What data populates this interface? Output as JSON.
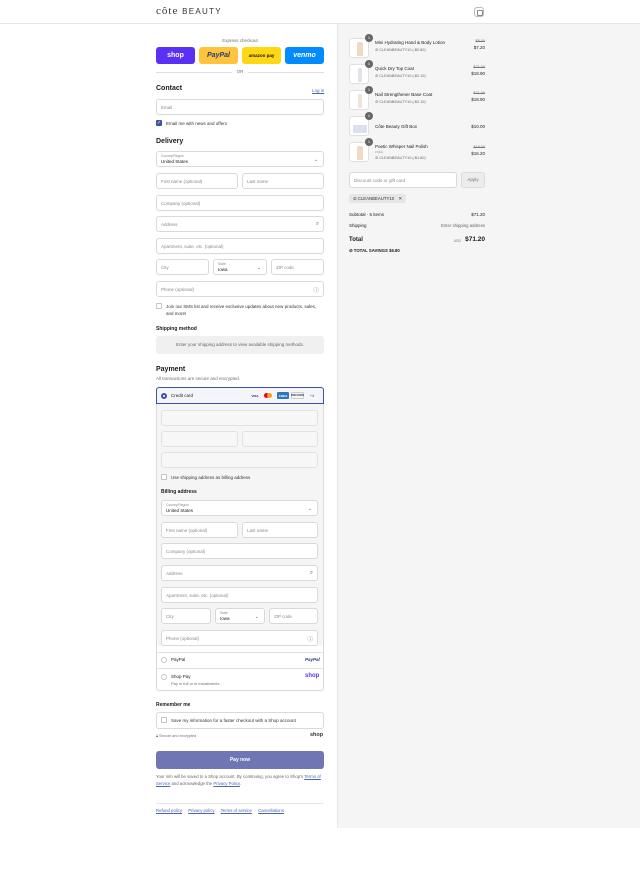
{
  "header": {
    "logo_main": "côte",
    "logo_sub": "BEAUTY"
  },
  "express": {
    "title": "Express checkout",
    "shop": "shop",
    "paypal": "PayPal",
    "amazon": "amazon pay",
    "venmo": "venmo",
    "or": "OR"
  },
  "contact": {
    "title": "Contact",
    "login": "Log in",
    "email_placeholder": "Email",
    "news_label": "Email me with news and offers"
  },
  "delivery": {
    "title": "Delivery",
    "country_label": "Country/Region",
    "country_value": "United States",
    "first_name": "First name (optional)",
    "last_name": "Last name",
    "company": "Company (optional)",
    "address": "Address",
    "apartment": "Apartment, suite, etc. (optional)",
    "city": "City",
    "state_label": "State",
    "state_value": "Iowa",
    "zip": "ZIP code",
    "phone": "Phone (optional)",
    "sms_label": "Join our SMS list and receive exclusive updates about new products, sales, and more!"
  },
  "shipping_method": {
    "title": "Shipping method",
    "message": "Enter your shipping address to view available shipping methods."
  },
  "payment": {
    "title": "Payment",
    "subtitle": "All transactions are secure and encrypted.",
    "credit_card": "Credit card",
    "brands": [
      "VISA",
      "MC",
      "AMEX",
      "DISCOVER"
    ],
    "more_brands": "+4",
    "use_shipping": "Use shipping address as billing address",
    "billing_title": "Billing address",
    "paypal": "PayPal",
    "paypal_logo": "PayPal",
    "shop_pay": "Shop Pay",
    "shop_pay_sub": "Pay in full or in installments",
    "shop_logo": "shop"
  },
  "remember": {
    "title": "Remember me",
    "label": "Save my information for a faster checkout with a Shop account",
    "secure": "Secure and encrypted",
    "shop_logo": "shop"
  },
  "pay_now": "Pay now",
  "terms": {
    "text1": "Your info will be saved to a Shop account. By continuing, you agree to Shop’s",
    "tos": "Terms of Service",
    "text2": "and acknowledge the",
    "privacy": "Privacy Policy",
    "end": "."
  },
  "footer": [
    "Refund policy",
    "Privacy policy",
    "Terms of service",
    "Cancellations"
  ],
  "order": {
    "items": [
      {
        "qty": "1",
        "name": "Mini Hydrating Hand & Body Lotion",
        "discount": "CLEANBEAUTY10 (-$0.80)",
        "original": "$8.00",
        "price": "$7.20",
        "color": "#f0d9c4"
      },
      {
        "qty": "1",
        "name": "Quick Dry Top Coat",
        "discount": "CLEANBEAUTY10 (-$2.10)",
        "original": "$21.00",
        "price": "$18.90",
        "color": "#eef0f3"
      },
      {
        "qty": "1",
        "name": "Nail Strengthener Base Coat",
        "discount": "CLEANBEAUTY10 (-$2.10)",
        "original": "$21.00",
        "price": "$18.90",
        "color": "#f3ece4"
      },
      {
        "qty": "1",
        "name": "Côte Beauty Gift Box",
        "discount": "",
        "original": "",
        "price": "$10.00",
        "color": "#dcdff0"
      },
      {
        "qty": "1",
        "name": "Poetic Whisper Nail Polish",
        "discount": "CLEANBEAUTY10 (-$1.80)",
        "original": "$18.00",
        "price": "$16.20",
        "color": "#f2d8c6"
      }
    ],
    "free_note": "FREE",
    "discount_placeholder": "Discount code or gift card",
    "apply": "Apply",
    "code_chip": "CLEANBEAUTY10",
    "subtotal_label": "Subtotal · 5 items",
    "subtotal_value": "$71.20",
    "shipping_label": "Shipping",
    "shipping_value": "Enter shipping address",
    "total_label": "Total",
    "currency": "USD",
    "total_value": "$71.20",
    "savings_label": "TOTAL SAVINGS",
    "savings_value": "$6.80"
  }
}
